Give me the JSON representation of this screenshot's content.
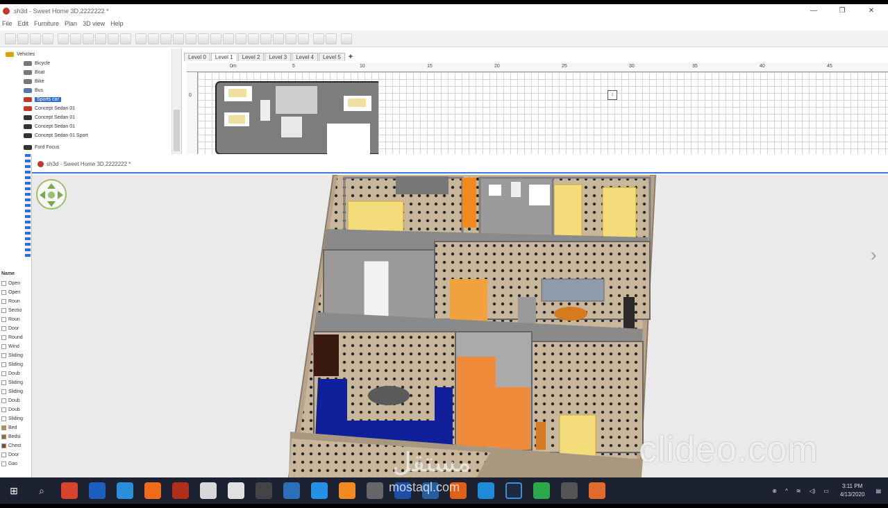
{
  "window": {
    "title": "sh3d - Sweet Home 3D,2222222 *",
    "minimize": "—",
    "maximize": "❐",
    "close": "✕"
  },
  "menu": [
    "File",
    "Edit",
    "Furniture",
    "Plan",
    "3D view",
    "Help"
  ],
  "catalog": {
    "items": [
      {
        "label": "Vehicles",
        "selected": false
      },
      {
        "label": "Bicycle",
        "selected": false
      },
      {
        "label": "Boat",
        "selected": false
      },
      {
        "label": "Bike",
        "selected": false
      },
      {
        "label": "Bus",
        "selected": false
      },
      {
        "label": "Sports car",
        "selected": true
      },
      {
        "label": "Concept Sedan 01",
        "selected": false
      },
      {
        "label": "Concept Sedan 01",
        "selected": false
      },
      {
        "label": "Concept Sedan 01",
        "selected": false
      },
      {
        "label": "Concept Sedan 01 Sport",
        "selected": false
      },
      {
        "label": "Ford Focus",
        "selected": false
      }
    ]
  },
  "plan": {
    "tabs": [
      "Level 0",
      "Level 1",
      "Level 2",
      "Level 3",
      "Level 4",
      "Level 5"
    ],
    "active_tab": 1,
    "add_tab": "+",
    "ruler_labels": [
      "0m",
      "5",
      "10",
      "15",
      "20",
      "25",
      "30",
      "35",
      "40",
      "45"
    ],
    "ruler_v_label": "0"
  },
  "view3d": {
    "title": "sh3d - Sweet Home 3D,2222222 *"
  },
  "properties": {
    "header": "Name",
    "rows": [
      "Open",
      "Open",
      "Roun",
      "Sectio",
      "Roun",
      "Door",
      "Round",
      "Wind",
      "Sliding",
      "Sliding",
      "Doub",
      "Sliding",
      "Sliding",
      "Doub",
      "Doub",
      "Sliding",
      "Bed",
      "Bedsi",
      "Chest",
      "Door",
      "Gas"
    ]
  },
  "taskbar": {
    "time": "3:11 PM",
    "date": "4/13/2020"
  },
  "watermarks": {
    "clideo": "clideo.com",
    "mostaql": "mostaql.com",
    "mostaql_ar": "مستقل"
  }
}
